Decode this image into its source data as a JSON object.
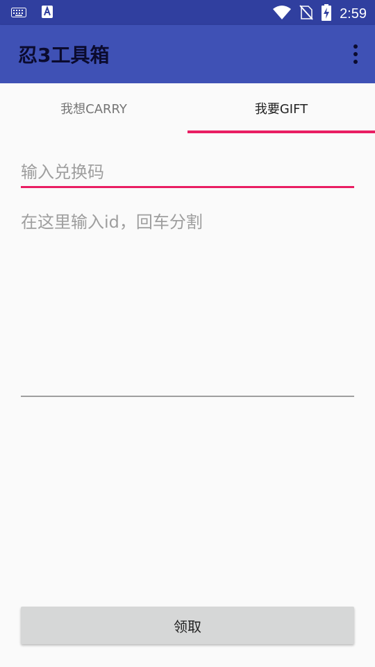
{
  "status_bar": {
    "time": "2:59",
    "left_icons": [
      "keyboard-icon",
      "text-app-icon"
    ],
    "right_icons": [
      "wifi-icon",
      "no-sim-icon",
      "battery-charging-icon"
    ]
  },
  "app_bar": {
    "title": "忍3工具箱",
    "menu_icon": "overflow-menu-icon"
  },
  "tabs": [
    {
      "label": "我想CARRY",
      "selected": false
    },
    {
      "label": "我要GIFT",
      "selected": true
    }
  ],
  "form": {
    "code_placeholder": "输入兑换码",
    "code_value": "",
    "ids_placeholder": "在这里输入id，回车分割",
    "ids_value": ""
  },
  "actions": {
    "claim_label": "领取"
  },
  "colors": {
    "status_bar": "#303f9f",
    "primary": "#3f51b5",
    "accent": "#e91e63",
    "background": "#fafafa",
    "button": "#d6d7d7"
  }
}
